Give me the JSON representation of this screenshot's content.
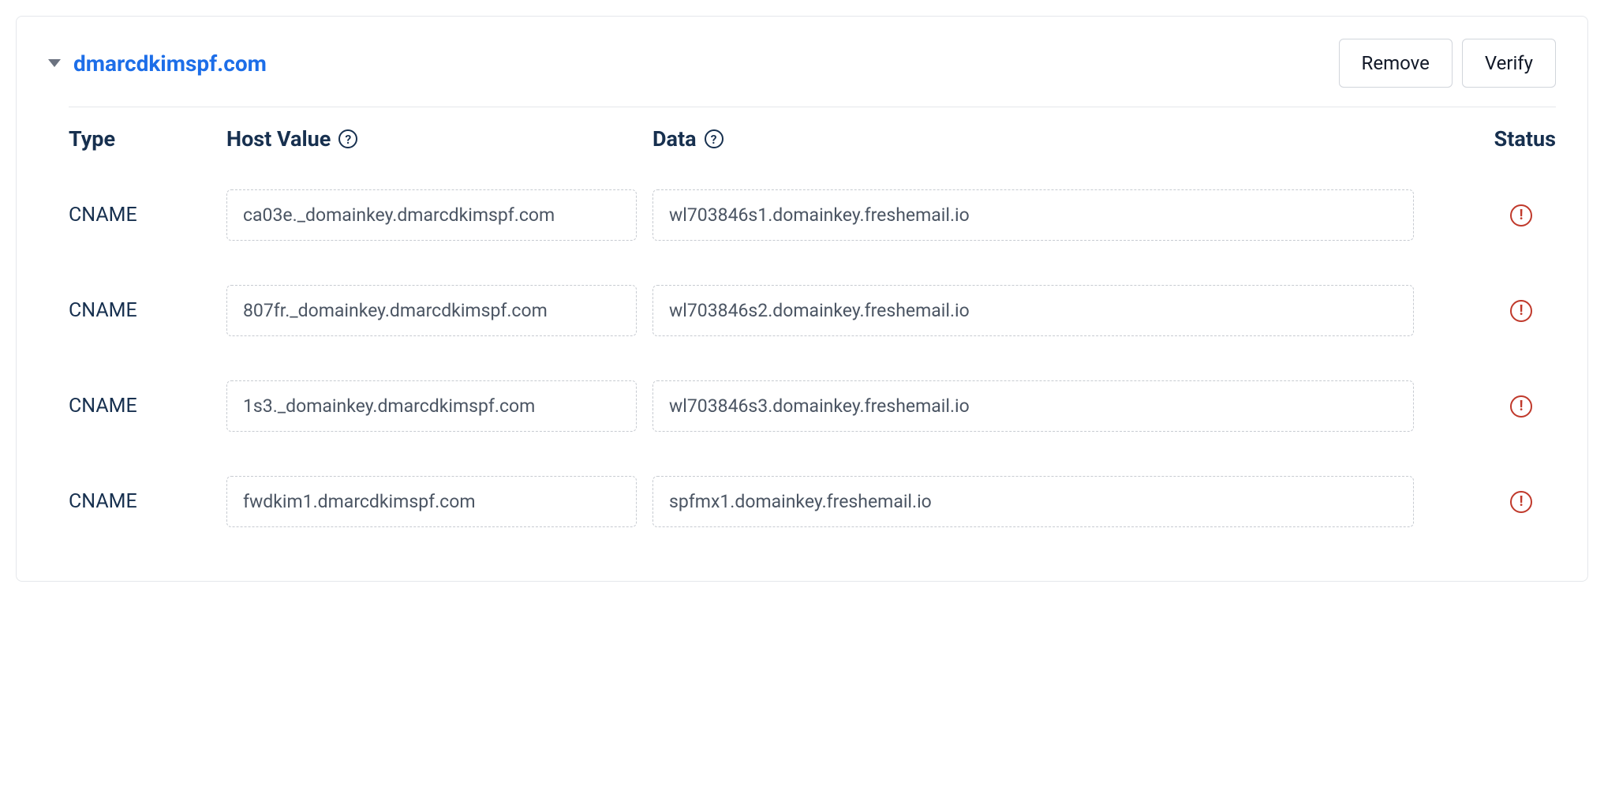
{
  "domain": "dmarcdkimspf.com",
  "buttons": {
    "remove": "Remove",
    "verify": "Verify"
  },
  "headers": {
    "type": "Type",
    "host": "Host Value",
    "data": "Data",
    "status": "Status"
  },
  "records": [
    {
      "type": "CNAME",
      "host": "ca03e._domainkey.dmarcdkimspf.com",
      "data": "wl703846s1.domainkey.freshemail.io",
      "status": "error"
    },
    {
      "type": "CNAME",
      "host": "807fr._domainkey.dmarcdkimspf.com",
      "data": "wl703846s2.domainkey.freshemail.io",
      "status": "error"
    },
    {
      "type": "CNAME",
      "host": "1s3._domainkey.dmarcdkimspf.com",
      "data": "wl703846s3.domainkey.freshemail.io",
      "status": "error"
    },
    {
      "type": "CNAME",
      "host": "fwdkim1.dmarcdkimspf.com",
      "data": "spfmx1.domainkey.freshemail.io",
      "status": "error"
    }
  ]
}
